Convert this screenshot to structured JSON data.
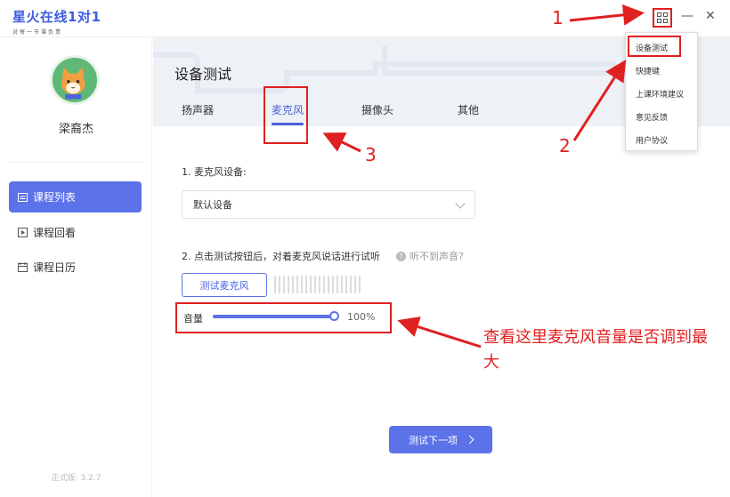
{
  "app": {
    "logo_text": "星火在线1对1",
    "logo_subtitle": "对每一节课负责"
  },
  "sidebar": {
    "username": "梁裔杰",
    "items": [
      {
        "label": "课程列表",
        "icon": "calendar-list-icon",
        "active": true
      },
      {
        "label": "课程回看",
        "icon": "play-icon",
        "active": false
      },
      {
        "label": "课程日历",
        "icon": "calendar-icon",
        "active": false
      }
    ],
    "version": "正式版: 3.2.7"
  },
  "main": {
    "title": "设备测试",
    "tabs": [
      {
        "label": "扬声器",
        "active": false
      },
      {
        "label": "麦克风",
        "active": true
      },
      {
        "label": "摄像头",
        "active": false
      },
      {
        "label": "其他",
        "active": false
      }
    ],
    "mic_device_label": "1. 麦克风设备:",
    "mic_device_value": "默认设备",
    "test_instruction": "2. 点击测试按钮后，对着麦克风说话进行试听",
    "help_text": "听不到声音?",
    "test_button_label": "测试麦克风",
    "volume_label": "音量",
    "volume_value": "100%",
    "volume_level": 1.0,
    "next_button_label": "测试下一项"
  },
  "menu": {
    "items": [
      "设备测试",
      "快捷键",
      "上课环境建议",
      "意见反馈",
      "用户协议"
    ]
  },
  "annotations": {
    "num1": "1",
    "num2": "2",
    "num3": "3",
    "note": "查看这里麦克风音量是否调到最大"
  },
  "colors": {
    "accent": "#5b72e8",
    "annotation_red": "#e02020",
    "header_bg": "#eef1f6"
  }
}
